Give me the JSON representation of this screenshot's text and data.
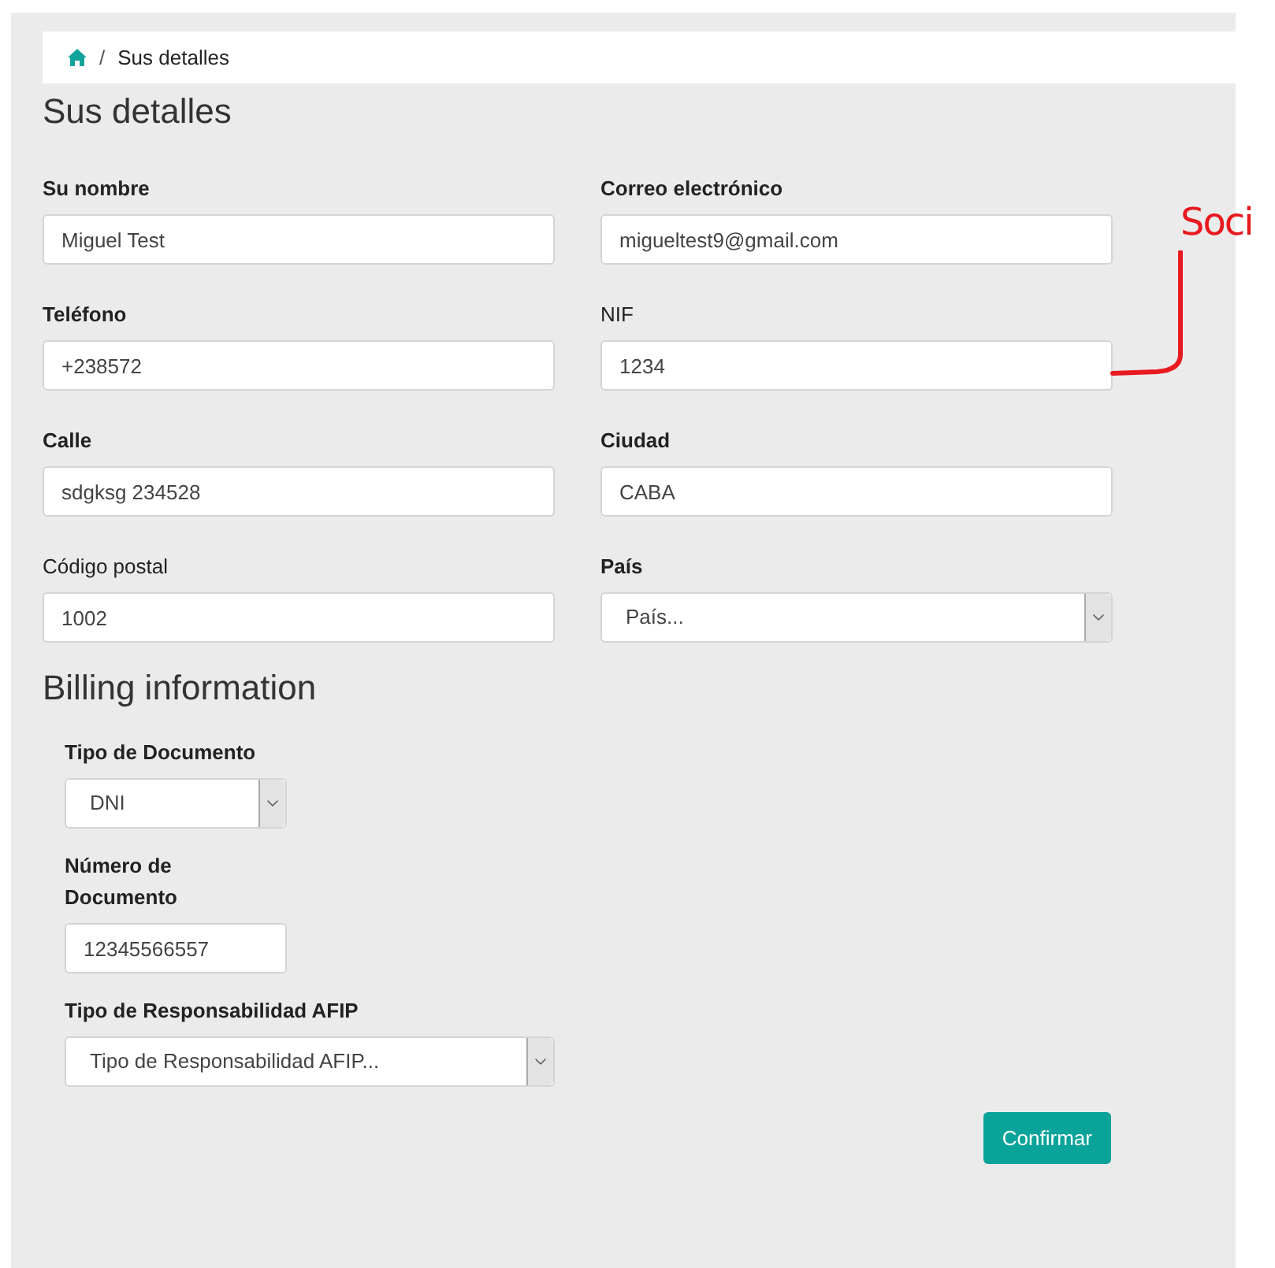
{
  "breadcrumb": {
    "separator": "/",
    "current": "Sus detalles"
  },
  "title": "Sus detalles",
  "fields": [
    {
      "label": "Su nombre",
      "bold": true,
      "kind": "input",
      "value": "Miguel Test"
    },
    {
      "label": "Correo electrónico",
      "bold": true,
      "kind": "input",
      "value": "migueltest9@gmail.com"
    },
    {
      "label": "Teléfono",
      "bold": true,
      "kind": "input",
      "value": "+238572"
    },
    {
      "label": "NIF",
      "bold": false,
      "kind": "input",
      "value": "1234"
    },
    {
      "label": "Calle",
      "bold": true,
      "kind": "input",
      "value": "sdgksg 234528"
    },
    {
      "label": "Ciudad",
      "bold": true,
      "kind": "input",
      "value": "CABA"
    },
    {
      "label": "Código postal",
      "bold": false,
      "kind": "input",
      "value": "1002"
    },
    {
      "label": "País",
      "bold": true,
      "kind": "select",
      "value": "País..."
    }
  ],
  "billing": {
    "title": "Billing information",
    "fields": [
      {
        "label": "Tipo de Documento",
        "bold": true,
        "kind": "select",
        "value": "DNI"
      },
      {
        "label": "Número de Documento",
        "bold": true,
        "kind": "input",
        "value": "12345566557"
      },
      {
        "label": "Tipo de Responsabilidad AFIP",
        "bold": true,
        "kind": "select",
        "value": "Tipo de Responsabilidad AFIP..."
      }
    ]
  },
  "confirm_button": "Confirmar",
  "annotation": {
    "text": "Soci"
  }
}
